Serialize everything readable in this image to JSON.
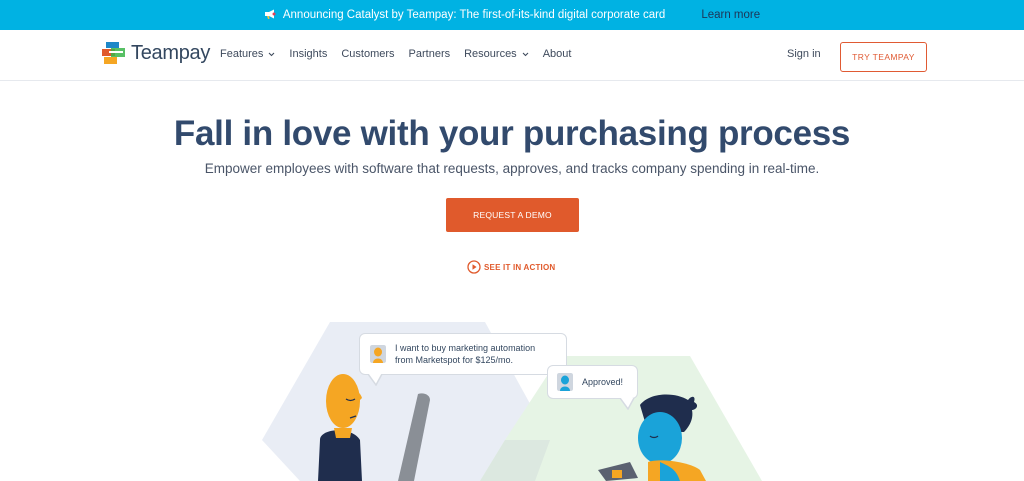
{
  "announcement": {
    "text": "Announcing Catalyst by Teampay: The first-of-its-kind digital corporate card",
    "link": "Learn more",
    "icon": "megaphone-icon"
  },
  "brand": {
    "name": "Teampay",
    "logo_icon": "teampay-logo-icon"
  },
  "nav": {
    "items": [
      {
        "label": "Features",
        "dropdown": true
      },
      {
        "label": "Insights",
        "dropdown": false
      },
      {
        "label": "Customers",
        "dropdown": false
      },
      {
        "label": "Partners",
        "dropdown": false
      },
      {
        "label": "Resources",
        "dropdown": true
      },
      {
        "label": "About",
        "dropdown": false
      }
    ],
    "sign_in": "Sign in",
    "try_button": "TRY TEAMPAY"
  },
  "hero": {
    "headline": "Fall in love with your purchasing process",
    "subhead": "Empower employees with software that requests, approves, and tracks company spending in real-time.",
    "demo_button": "REQUEST A DEMO",
    "see_action": "SEE IT IN ACTION"
  },
  "illustration": {
    "request_line1": "I want to buy marketing automation",
    "request_line2": "from Marketspot for $125/mo.",
    "approved": "Approved!"
  },
  "colors": {
    "announce_bg": "#00b2e3",
    "accent_orange": "#e05a2c",
    "heading": "#324a6d"
  }
}
